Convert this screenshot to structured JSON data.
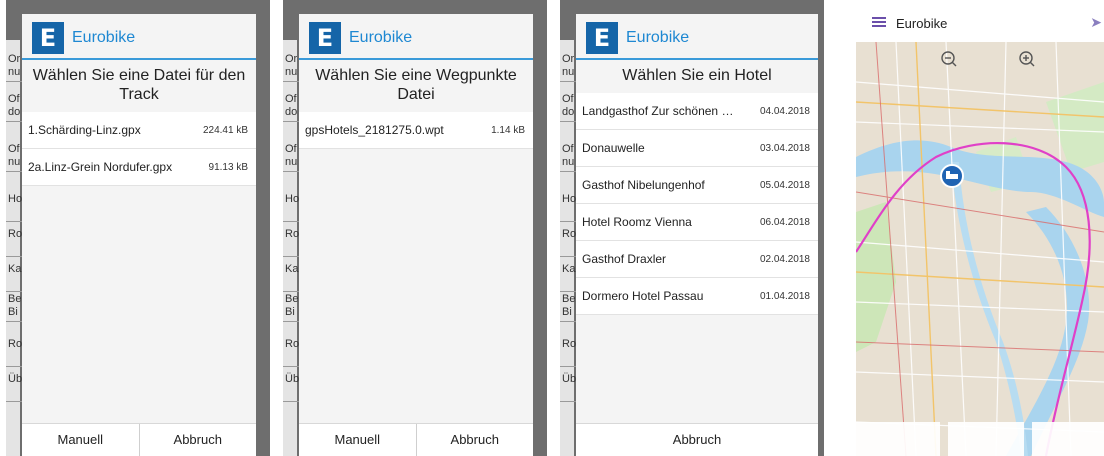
{
  "brand": "Eurobike",
  "background_rows": [
    "Or nu",
    "Of do",
    "Of nu",
    "Ho",
    "Ro",
    "Ka",
    "Be Bi",
    "Ro",
    "Üb"
  ],
  "dialogs": [
    {
      "title": "Wählen Sie eine Datei für den Track",
      "items": [
        {
          "name": "1.Schärding-Linz.gpx",
          "meta": "224.41 kB"
        },
        {
          "name": "2a.Linz-Grein Nordufer.gpx",
          "meta": "91.13 kB"
        }
      ],
      "buttons": [
        "Manuell",
        "Abbruch"
      ]
    },
    {
      "title": "Wählen Sie eine Wegpunkte Datei",
      "items": [
        {
          "name": "gpsHotels_2181275.0.wpt",
          "meta": "1.14 kB"
        }
      ],
      "buttons": [
        "Manuell",
        "Abbruch"
      ]
    },
    {
      "title": "Wählen Sie ein Hotel",
      "items": [
        {
          "name": "Landgasthof Zur schönen Wi…",
          "meta": "04.04.2018"
        },
        {
          "name": "Donauwelle",
          "meta": "03.04.2018"
        },
        {
          "name": "Gasthof Nibelungenhof",
          "meta": "05.04.2018"
        },
        {
          "name": "Hotel Roomz Vienna",
          "meta": "06.04.2018"
        },
        {
          "name": "Gasthof Draxler",
          "meta": "02.04.2018"
        },
        {
          "name": "Dormero Hotel Passau",
          "meta": "01.04.2018"
        }
      ],
      "buttons": [
        "Abbruch"
      ]
    }
  ],
  "map": {
    "title": "Eurobike",
    "icons": [
      "menu-icon",
      "navigation-arrow-icon",
      "zoom-out-icon",
      "zoom-in-icon",
      "hotel-marker-icon"
    ],
    "colors": {
      "route": "#e040c8",
      "river": "#a9d4ee",
      "accent": "#3a9ad9"
    }
  }
}
